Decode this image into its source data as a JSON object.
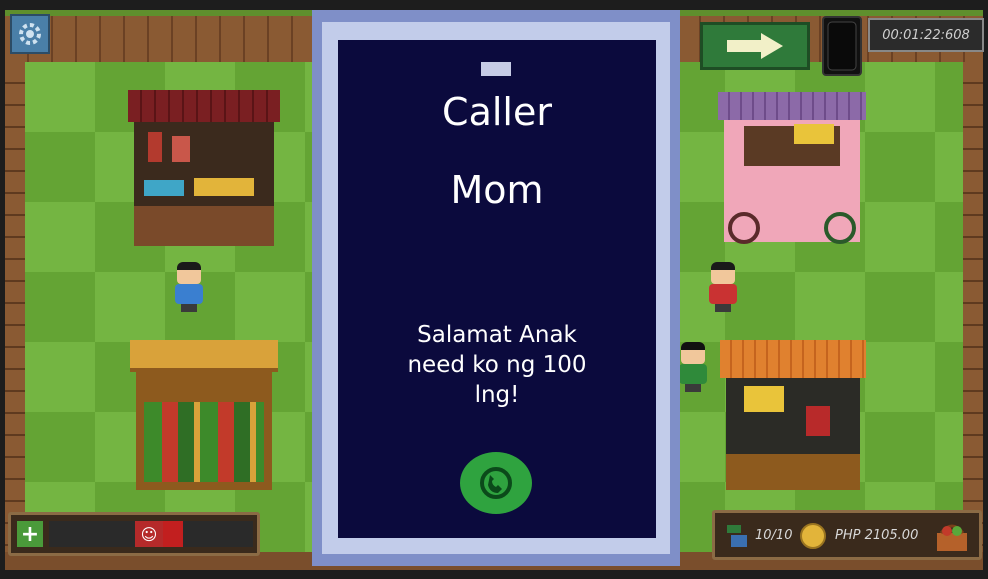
{
  "game": {
    "timer": "00:01:22:608",
    "stock": "10/10",
    "money": "PHP 2105.00",
    "hud_plus": "+",
    "hud_face": "☺"
  },
  "call": {
    "title": "Caller",
    "caller": "Mom",
    "message_lines": [
      "Salamat Anak",
      "need ko ng 100",
      "lng!"
    ]
  },
  "icons": [
    "gear-icon",
    "arrow-right-icon",
    "phone-icon",
    "customers-icon",
    "coin-icon",
    "basket-icon",
    "call-icon"
  ],
  "colors": {
    "modal_bg": "#0b0a3d",
    "modal_border": "#7f8fc8",
    "call_button": "#2fa33f",
    "grass": "#74b542"
  }
}
